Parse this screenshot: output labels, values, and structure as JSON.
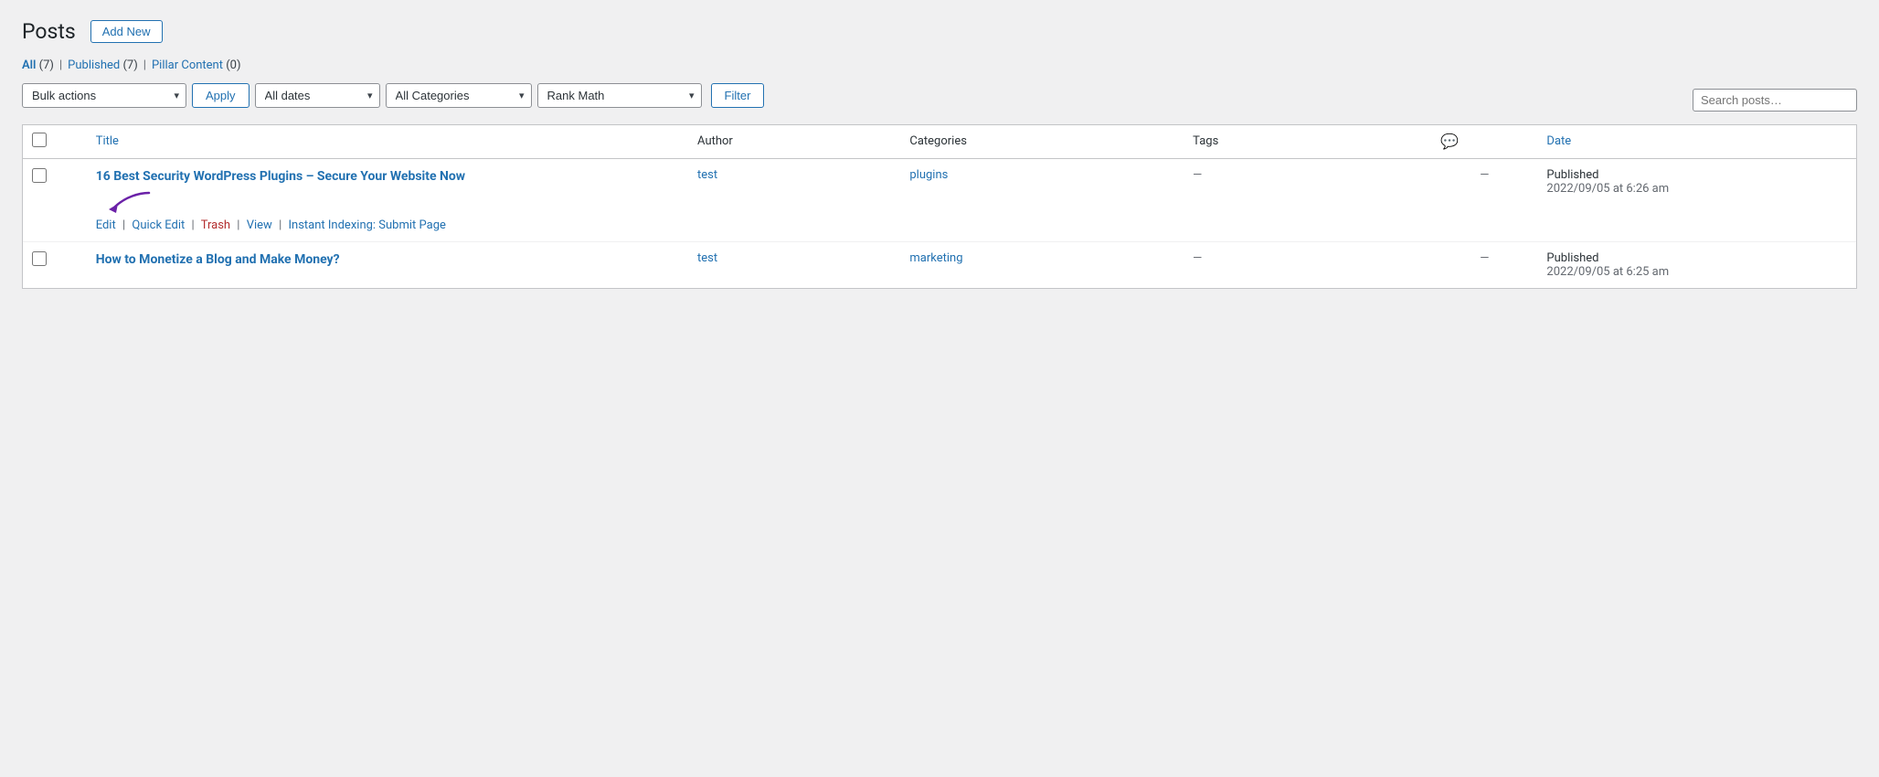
{
  "header": {
    "title": "Posts",
    "add_new_label": "Add New"
  },
  "subsubsub": {
    "items": [
      {
        "label": "All",
        "count": "(7)",
        "active": true
      },
      {
        "label": "Published",
        "count": "(7)",
        "active": false
      },
      {
        "label": "Pillar Content",
        "count": "(0)",
        "active": false
      }
    ]
  },
  "filters": {
    "bulk_actions_label": "Bulk actions",
    "apply_label": "Apply",
    "all_dates_label": "All dates",
    "all_categories_label": "All Categories",
    "rank_math_label": "Rank Math",
    "filter_label": "Filter"
  },
  "table": {
    "columns": {
      "title": "Title",
      "author": "Author",
      "categories": "Categories",
      "tags": "Tags",
      "date": "Date"
    },
    "rows": [
      {
        "id": 1,
        "title": "16 Best Security WordPress Plugins – Secure Your Website Now",
        "author": "test",
        "categories": "plugins",
        "tags": "—",
        "comments": "—",
        "date_status": "Published",
        "date_value": "2022/09/05 at 6:26 am",
        "actions": {
          "edit": "Edit",
          "quick_edit": "Quick Edit",
          "trash": "Trash",
          "view": "View",
          "instant_indexing": "Instant Indexing: Submit Page"
        },
        "has_arrow": true
      },
      {
        "id": 2,
        "title": "How to Monetize a Blog and Make Money?",
        "author": "test",
        "categories": "marketing",
        "tags": "—",
        "comments": "—",
        "date_status": "Published",
        "date_value": "2022/09/05 at 6:25 am",
        "actions": null,
        "has_arrow": false
      }
    ]
  }
}
